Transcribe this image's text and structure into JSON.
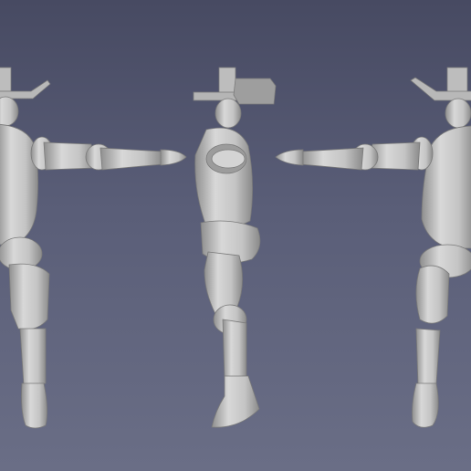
{
  "viewport": {
    "background_top": "#474a62",
    "background_bottom": "#6a6e86",
    "clay_color": "#c9c9c9"
  },
  "views": [
    "front-view",
    "side-view",
    "back-view"
  ]
}
